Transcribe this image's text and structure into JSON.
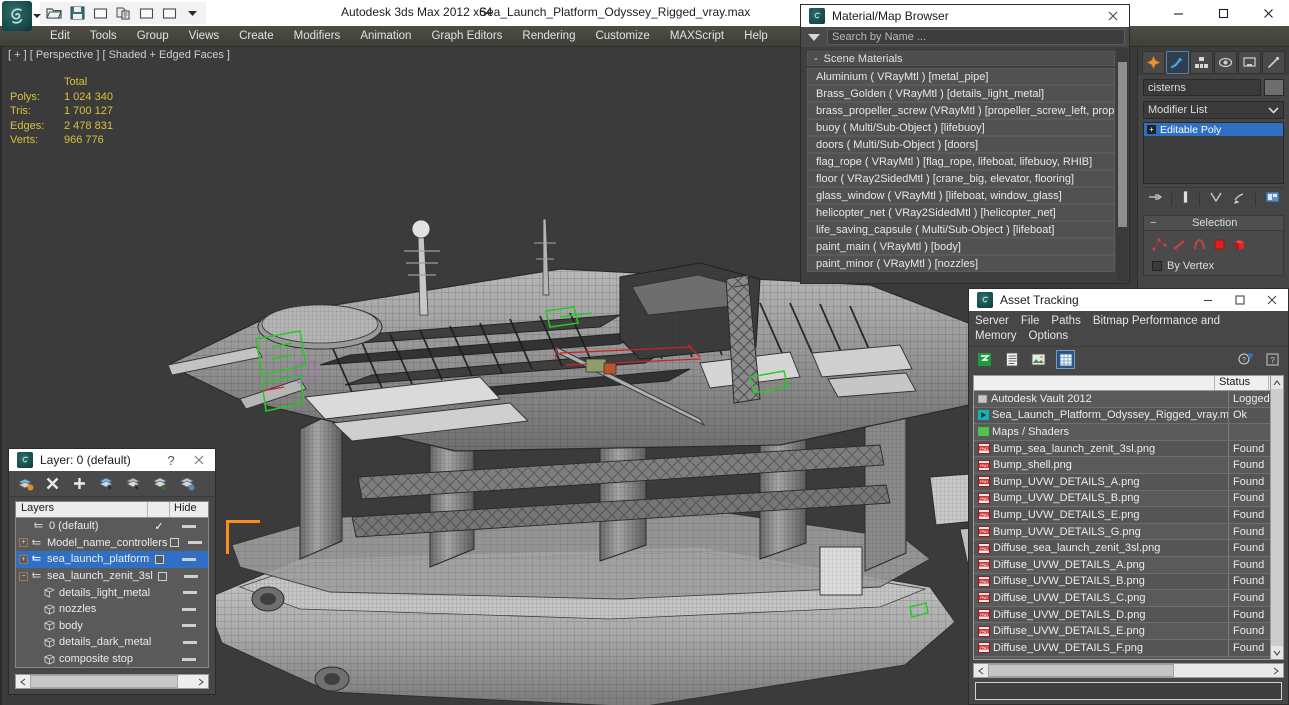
{
  "titlebar": {
    "app_title": "Autodesk 3ds Max  2012 x64",
    "file_title": "Sea_Launch_Platform_Odyssey_Rigged_vray.max",
    "quick_access": [
      {
        "name": "open-file-icon",
        "label": "Open File"
      },
      {
        "name": "save-file-icon",
        "label": "Save File"
      },
      {
        "name": "undo-icon",
        "label": "Undo"
      },
      {
        "name": "redo-icon",
        "label": "Redo"
      },
      {
        "name": "set-key-icon",
        "label": "Set Key"
      },
      {
        "name": "key-filters-icon",
        "label": "Key Filters"
      }
    ],
    "window_buttons": [
      "minimize",
      "maximize",
      "close"
    ]
  },
  "menubar": {
    "items": [
      {
        "label": "Edit"
      },
      {
        "label": "Tools"
      },
      {
        "label": "Group"
      },
      {
        "label": "Views"
      },
      {
        "label": "Create"
      },
      {
        "label": "Modifiers"
      },
      {
        "label": "Animation"
      },
      {
        "label": "Graph Editors"
      },
      {
        "label": "Rendering"
      },
      {
        "label": "Customize"
      },
      {
        "label": "MAXScript"
      },
      {
        "label": "Help"
      }
    ]
  },
  "viewport": {
    "label": "[ + ] [ Perspective ] [ Shaded + Edged Faces ]",
    "stats_header": "Total",
    "stats": [
      {
        "label": "Polys:",
        "value": "1 024 340"
      },
      {
        "label": "Tris:",
        "value": "1 700 127"
      },
      {
        "label": "Edges:",
        "value": "2 478 831"
      },
      {
        "label": "Verts:",
        "value": "966 776"
      }
    ],
    "background_color": "#3b3b3b",
    "stats_color": "#d6c23c",
    "selection_bracket_color": "#ff8c1a"
  },
  "command_panel": {
    "tabs": [
      {
        "name": "create-tab",
        "label": "Create",
        "active": false
      },
      {
        "name": "modify-tab",
        "label": "Modify",
        "active": true
      },
      {
        "name": "hierarchy-tab",
        "label": "Hierarchy",
        "active": false
      },
      {
        "name": "motion-tab",
        "label": "Motion",
        "active": false
      },
      {
        "name": "display-tab",
        "label": "Display",
        "active": false
      },
      {
        "name": "utilities-tab",
        "label": "Utilities",
        "active": false
      }
    ],
    "object_name": "cisterns",
    "modifier_list_label": "Modifier List",
    "stack": [
      {
        "label": "Editable Poly",
        "selected": true
      }
    ],
    "stack_buttons": [
      {
        "name": "pin-stack-icon"
      },
      {
        "name": "show-end-result-icon"
      },
      {
        "name": "make-unique-icon"
      },
      {
        "name": "remove-modifier-icon"
      },
      {
        "name": "configure-modifier-sets-icon"
      }
    ],
    "rollout": {
      "title": "Selection",
      "sub_object_levels": [
        "vertex",
        "edge",
        "border",
        "polygon",
        "element"
      ],
      "by_vertex_label": "By Vertex"
    }
  },
  "material_browser": {
    "title": "Material/Map Browser",
    "search_placeholder": "Search by Name ...",
    "section_label": "Scene Materials",
    "section_collapse": "-",
    "items": [
      "Aluminium  ( VRayMtl )  [metal_pipe]",
      "Brass_Golden ( VRayMtl ) [details_light_metal]",
      "brass_propeller_screw (VRayMtl ) [propeller_screw_left, propell...",
      "buoy  ( Multi/Sub-Object )  [lifebuoy]",
      "doors  ( Multi/Sub-Object )  [doors]",
      "flag_rope ( VRayMtl ) [flag_rope, lifeboat, lifebuoy, RHIB]",
      "floor  ( VRay2SidedMtl )  [crane_big, elevator, flooring]",
      "glass_window ( VRayMtl ) [lifeboat, window_glass]",
      "helicopter_net ( VRay2SidedMtl )  [helicopter_net]",
      "life_saving_capsule  ( Multi/Sub-Object )  [lifeboat]",
      "paint_main  ( VRayMtl )  [body]",
      "paint_minor  ( VRayMtl )  [nozzles]"
    ]
  },
  "asset_tracking": {
    "title": "Asset Tracking",
    "menus": [
      "Server",
      "File",
      "Paths",
      "Bitmap Performance and Memory",
      "Options"
    ],
    "toolbar": [
      {
        "name": "refresh-icon",
        "active": false
      },
      {
        "name": "list-view-icon",
        "active": false
      },
      {
        "name": "thumbnail-view-icon",
        "active": false
      },
      {
        "name": "grid-view-icon",
        "active": true
      },
      {
        "name": "help-icon",
        "active": false
      },
      {
        "name": "about-icon",
        "active": false
      }
    ],
    "columns": [
      "",
      "Status"
    ],
    "rows": [
      {
        "indent": 1,
        "icon": "vault-icon",
        "name": "Autodesk Vault 2012",
        "status": "Logged"
      },
      {
        "indent": 1,
        "icon": "max-file-icon",
        "name": "Sea_Launch_Platform_Odyssey_Rigged_vray.max",
        "status": "Ok"
      },
      {
        "indent": 2,
        "icon": "folder-icon",
        "name": "Maps / Shaders",
        "status": ""
      },
      {
        "indent": 3,
        "icon": "png-icon",
        "name": "Bump_sea_launch_zenit_3sl.png",
        "status": "Found"
      },
      {
        "indent": 3,
        "icon": "png-icon",
        "name": "Bump_shell.png",
        "status": "Found"
      },
      {
        "indent": 3,
        "icon": "png-icon",
        "name": "Bump_UVW_DETAILS_A.png",
        "status": "Found"
      },
      {
        "indent": 3,
        "icon": "png-icon",
        "name": "Bump_UVW_DETAILS_B.png",
        "status": "Found"
      },
      {
        "indent": 3,
        "icon": "png-icon",
        "name": "Bump_UVW_DETAILS_E.png",
        "status": "Found"
      },
      {
        "indent": 3,
        "icon": "png-icon",
        "name": "Bump_UVW_DETAILS_G.png",
        "status": "Found"
      },
      {
        "indent": 3,
        "icon": "png-icon",
        "name": "Diffuse_sea_launch_zenit_3sl.png",
        "status": "Found"
      },
      {
        "indent": 3,
        "icon": "png-icon",
        "name": "Diffuse_UVW_DETAILS_A.png",
        "status": "Found"
      },
      {
        "indent": 3,
        "icon": "png-icon",
        "name": "Diffuse_UVW_DETAILS_B.png",
        "status": "Found"
      },
      {
        "indent": 3,
        "icon": "png-icon",
        "name": "Diffuse_UVW_DETAILS_C.png",
        "status": "Found"
      },
      {
        "indent": 3,
        "icon": "png-icon",
        "name": "Diffuse_UVW_DETAILS_D.png",
        "status": "Found"
      },
      {
        "indent": 3,
        "icon": "png-icon",
        "name": "Diffuse_UVW_DETAILS_E.png",
        "status": "Found"
      },
      {
        "indent": 3,
        "icon": "png-icon",
        "name": "Diffuse_UVW_DETAILS_F.png",
        "status": "Found"
      }
    ]
  },
  "layer_manager": {
    "title": "Layer: 0 (default)",
    "help_label": "?",
    "toolbar": [
      {
        "name": "create-new-layer-icon"
      },
      {
        "name": "delete-layer-icon"
      },
      {
        "name": "add-selection-to-layer-icon"
      },
      {
        "name": "select-objects-in-layer-icon"
      },
      {
        "name": "highlight-selected-objects-icon"
      },
      {
        "name": "set-current-layer-icon"
      },
      {
        "name": "layer-properties-icon"
      }
    ],
    "columns": [
      "Layers",
      "",
      "Hide"
    ],
    "rows": [
      {
        "indent": 1,
        "type": "layer",
        "name": "0 (default)",
        "current": true,
        "hide": false,
        "selected": false,
        "expander": "none"
      },
      {
        "indent": 1,
        "type": "layer",
        "name": "Model_name_controllers",
        "current": false,
        "hide": false,
        "selected": false,
        "expander": "plus"
      },
      {
        "indent": 1,
        "type": "layer",
        "name": "sea_launch_platform",
        "current": false,
        "hide": false,
        "selected": true,
        "expander": "plus"
      },
      {
        "indent": 1,
        "type": "layer",
        "name": "sea_launch_zenit_3sl",
        "current": false,
        "hide": false,
        "selected": false,
        "expander": "minus"
      },
      {
        "indent": 2,
        "type": "object",
        "name": "details_light_metal",
        "current": false,
        "hide": false,
        "selected": false,
        "expander": "none"
      },
      {
        "indent": 2,
        "type": "object",
        "name": "nozzles",
        "current": false,
        "hide": false,
        "selected": false,
        "expander": "none"
      },
      {
        "indent": 2,
        "type": "object",
        "name": "body",
        "current": false,
        "hide": false,
        "selected": false,
        "expander": "none"
      },
      {
        "indent": 2,
        "type": "object",
        "name": "details_dark_metal",
        "current": false,
        "hide": false,
        "selected": false,
        "expander": "none"
      },
      {
        "indent": 2,
        "type": "object",
        "name": "composite stop",
        "current": false,
        "hide": false,
        "selected": false,
        "expander": "none"
      }
    ]
  },
  "colors": {
    "accent_blue": "#2f6fc4",
    "panel_gray": "#474747",
    "viewport_gray": "#3b3b3b",
    "stats_yellow": "#d6c23c",
    "selection_orange": "#ff8c1a",
    "wire_green": "#22cc22",
    "wire_red": "#cc2222"
  }
}
